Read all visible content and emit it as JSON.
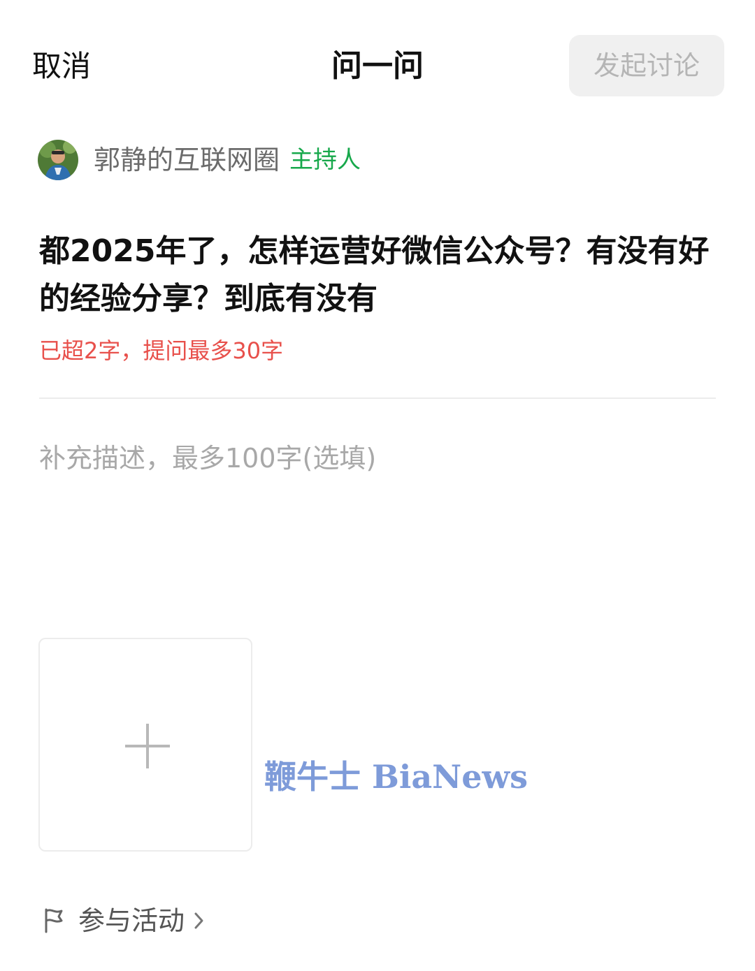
{
  "header": {
    "cancel_label": "取消",
    "title": "问一问",
    "post_label": "发起讨论"
  },
  "author": {
    "name": "郭静的互联网圈",
    "badge": "主持人",
    "badge_color": "#17a84b"
  },
  "question": {
    "text": "都2025年了，怎样运营好微信公众号？有没有好的经验分享？到底有没有",
    "warning": "已超2字，提问最多30字",
    "warning_color": "#e8504b"
  },
  "description": {
    "placeholder": "补充描述，最多100字(选填)"
  },
  "upload": {
    "icon": "plus-icon"
  },
  "watermark": {
    "text": "鞭牛士 BiaNews"
  },
  "activity": {
    "icon": "flag-icon",
    "label": "参与活动",
    "chevron": "chevron-right-icon"
  }
}
